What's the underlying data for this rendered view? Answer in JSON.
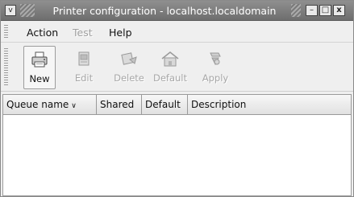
{
  "window": {
    "title": "Printer configuration - localhost.localdomain",
    "menu_glyph": "v",
    "minimize_glyph": "–",
    "maximize_glyph": "□",
    "close_glyph": "x"
  },
  "menubar": {
    "items": [
      {
        "label": "Action",
        "enabled": true
      },
      {
        "label": "Test",
        "enabled": false
      },
      {
        "label": "Help",
        "enabled": true
      }
    ]
  },
  "toolbar": {
    "buttons": [
      {
        "label": "New",
        "icon": "printer-new-icon",
        "enabled": true
      },
      {
        "label": "Edit",
        "icon": "edit-icon",
        "enabled": false
      },
      {
        "label": "Delete",
        "icon": "delete-icon",
        "enabled": false
      },
      {
        "label": "Default",
        "icon": "home-default-icon",
        "enabled": false
      },
      {
        "label": "Apply",
        "icon": "apply-icon",
        "enabled": false
      }
    ]
  },
  "table": {
    "columns": [
      {
        "label": "Queue name",
        "sort_indicator": "∨"
      },
      {
        "label": "Shared"
      },
      {
        "label": "Default"
      },
      {
        "label": "Description"
      }
    ],
    "rows": []
  }
}
